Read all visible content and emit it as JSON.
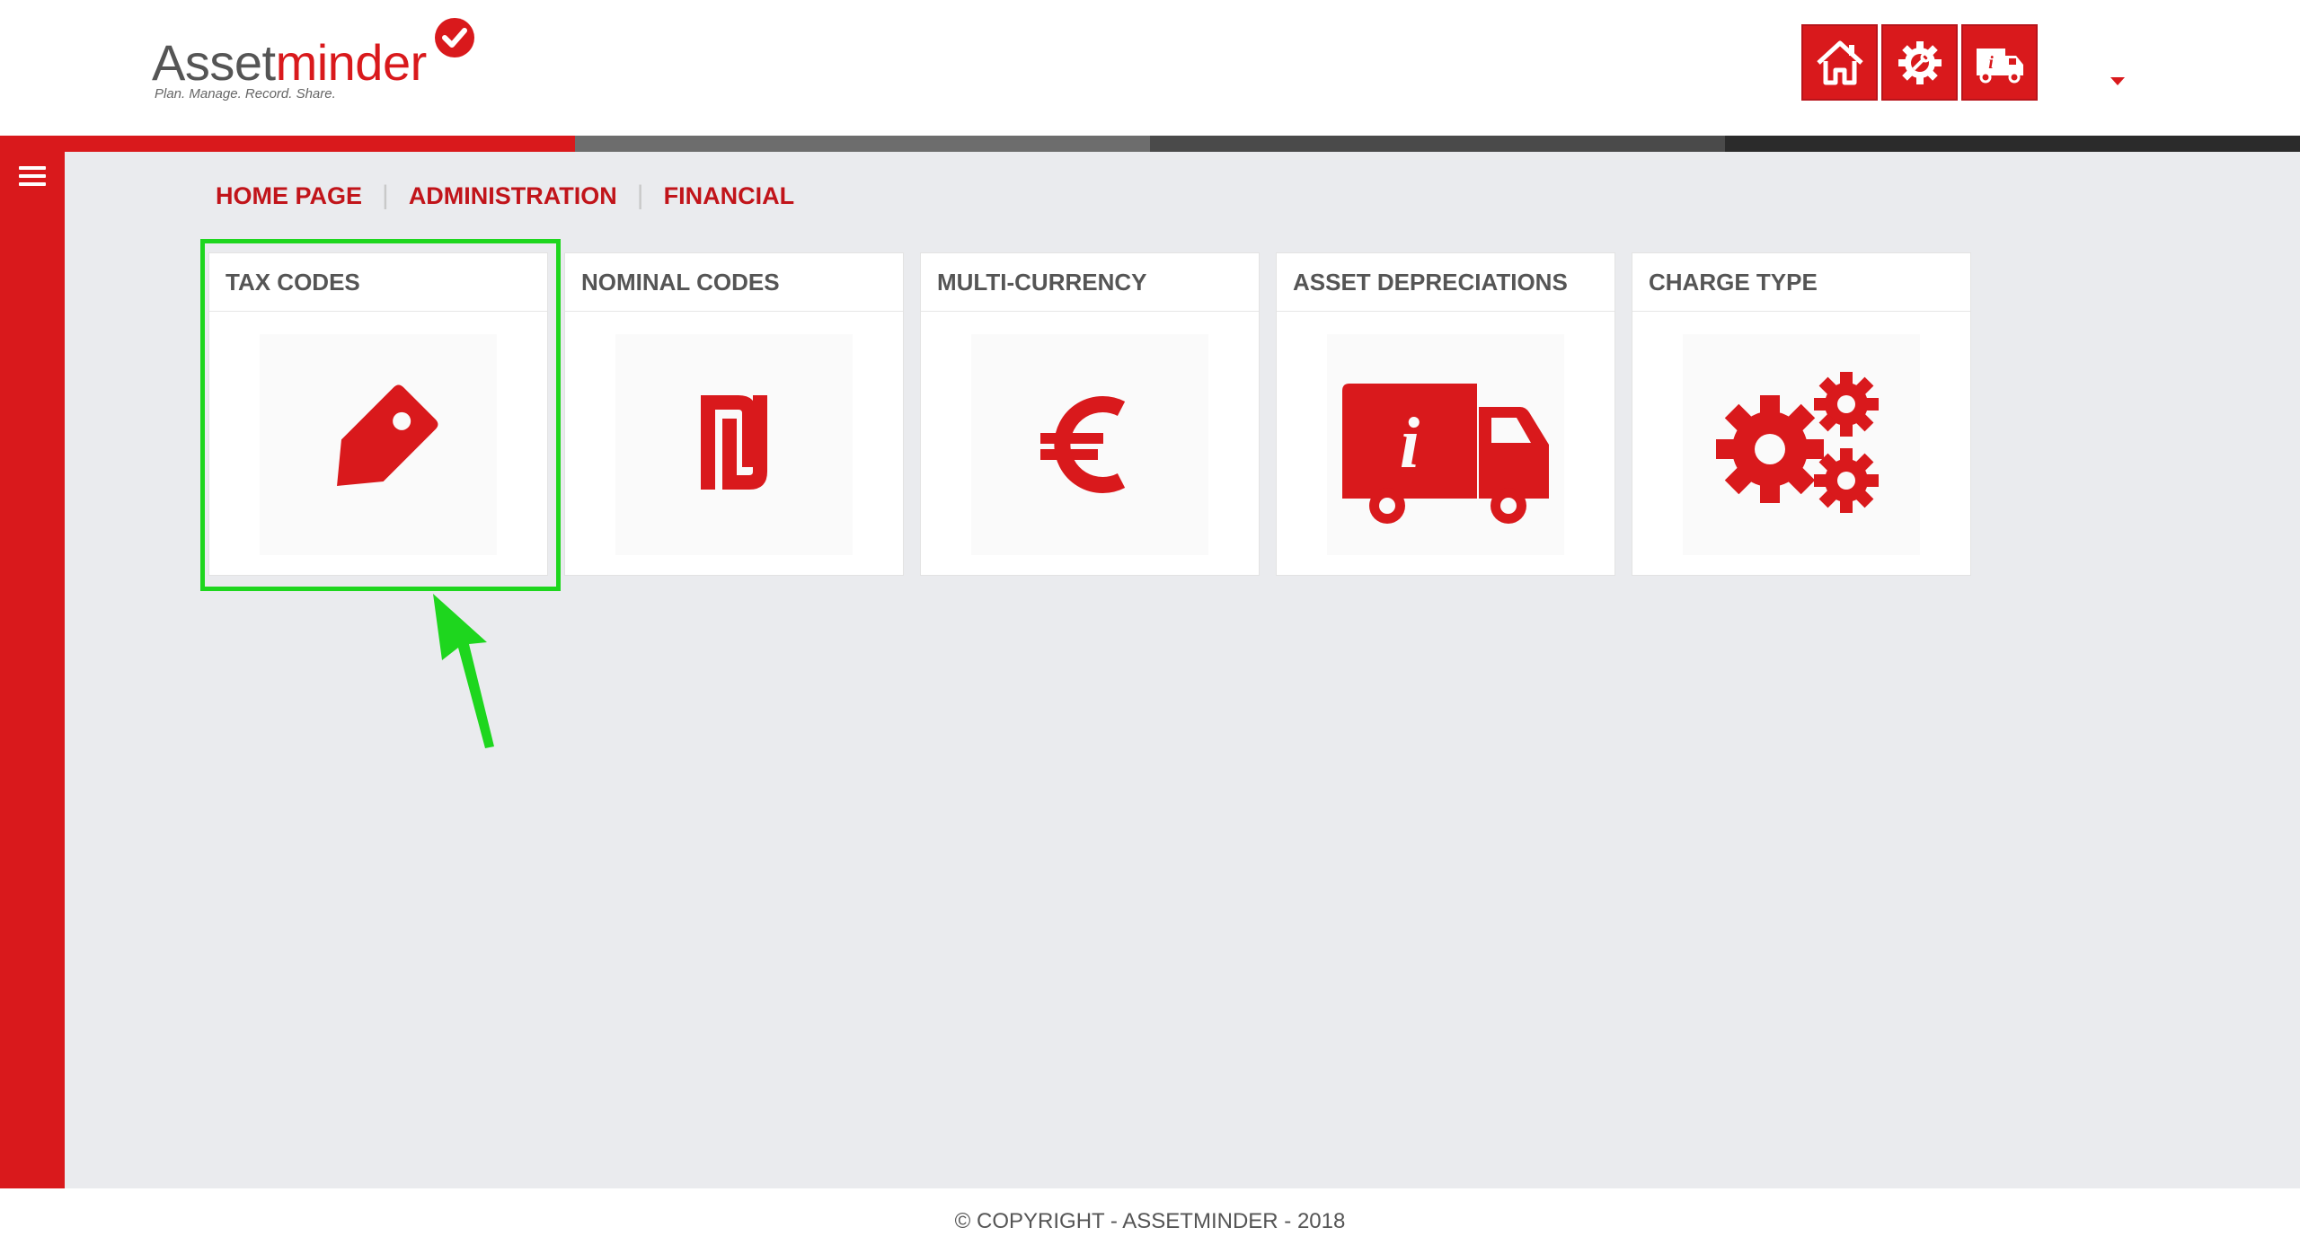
{
  "brand": {
    "name_part1": "Asset",
    "name_part2": "minder",
    "tagline": "Plan. Manage. Record. Share.",
    "accent_color": "#d9191c"
  },
  "header": {
    "buttons": [
      {
        "icon": "home-icon"
      },
      {
        "icon": "gear-wrench-icon"
      },
      {
        "icon": "truck-info-icon"
      }
    ],
    "user_menu_icon": "caret-down-icon"
  },
  "stripe_colors": [
    "#d9191c",
    "#6d6d6d",
    "#4a4a4a",
    "#2b2b2b"
  ],
  "sidebar": {
    "menu_icon": "hamburger-icon"
  },
  "breadcrumb": {
    "items": [
      "HOME PAGE",
      "ADMINISTRATION",
      "FINANCIAL"
    ],
    "separator": "|"
  },
  "tiles": [
    {
      "title": "TAX CODES",
      "icon": "tag-icon"
    },
    {
      "title": "NOMINAL CODES",
      "icon": "shekel-icon"
    },
    {
      "title": "MULTI-CURRENCY",
      "icon": "euro-icon"
    },
    {
      "title": "ASSET DEPRECIATIONS",
      "icon": "truck-info-icon"
    },
    {
      "title": "CHARGE TYPE",
      "icon": "gears-icon"
    }
  ],
  "annotation": {
    "highlight_color": "#1ed61e"
  },
  "footer": {
    "copyright": "© COPYRIGHT - ASSETMINDER - 2018"
  }
}
